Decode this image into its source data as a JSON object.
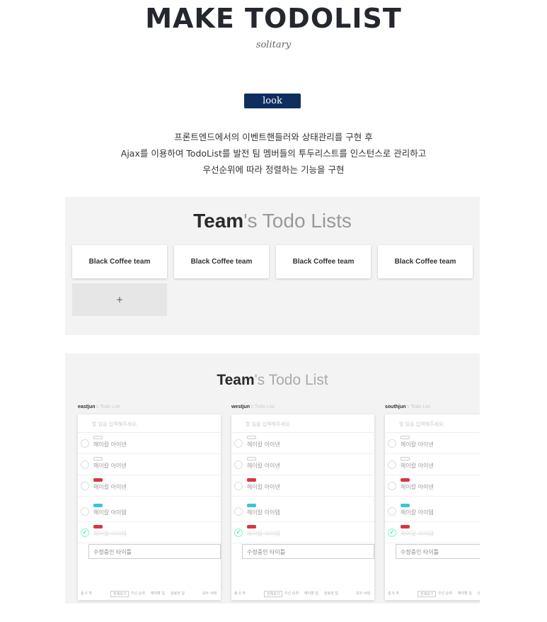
{
  "header": {
    "title": "MAKE TODOLIST",
    "subtitle": "solitary"
  },
  "look_button": "look",
  "description": [
    "프론트엔드에서의 이벤트핸들러와 상태관리를 구현 후",
    "Ajax를 이용하여 TodoList를 발전 팀 멤버들의 투두리스트를 인스턴스로 관리하고",
    "우선순위에 따라 정렬하는 기능을 구현"
  ],
  "screenshot1": {
    "heading_bold": "Team",
    "heading_rest": "'s Todo Lists",
    "teams": [
      "Black Coffee team",
      "Black Coffee team",
      "Black Coffee team",
      "Black Coffee team"
    ],
    "add_label": "+"
  },
  "screenshot2": {
    "heading_bold": "Team",
    "heading_rest": "'s Todo List",
    "members": [
      {
        "name": "eastjun",
        "suffix": "'s Todo List"
      },
      {
        "name": "westjun",
        "suffix": "'s Todo List"
      },
      {
        "name": "southjun",
        "suffix": "'s Todo List"
      }
    ],
    "input_placeholder": "할 일을 입력해주세요.",
    "items": [
      {
        "text": "헤이칼 아이넨",
        "chip": "none",
        "done": false
      },
      {
        "text": "헤이칼 아이넨",
        "chip": "none",
        "done": false
      },
      {
        "text": "헤이칼 아이넨",
        "chip": "red",
        "done": false
      },
      {
        "text": "헤이칼 아이템",
        "chip": "cyan",
        "done": false
      },
      {
        "text": "해야할 아이템",
        "chip": "red",
        "done": true
      }
    ],
    "editing_text": "수정중인 타이틀",
    "footer": {
      "count": "총 0 개",
      "all": "전체보기",
      "priority": "우선 순위",
      "todo": "해야할 일",
      "done": "완료한 일",
      "clear": "모두 삭제"
    }
  }
}
